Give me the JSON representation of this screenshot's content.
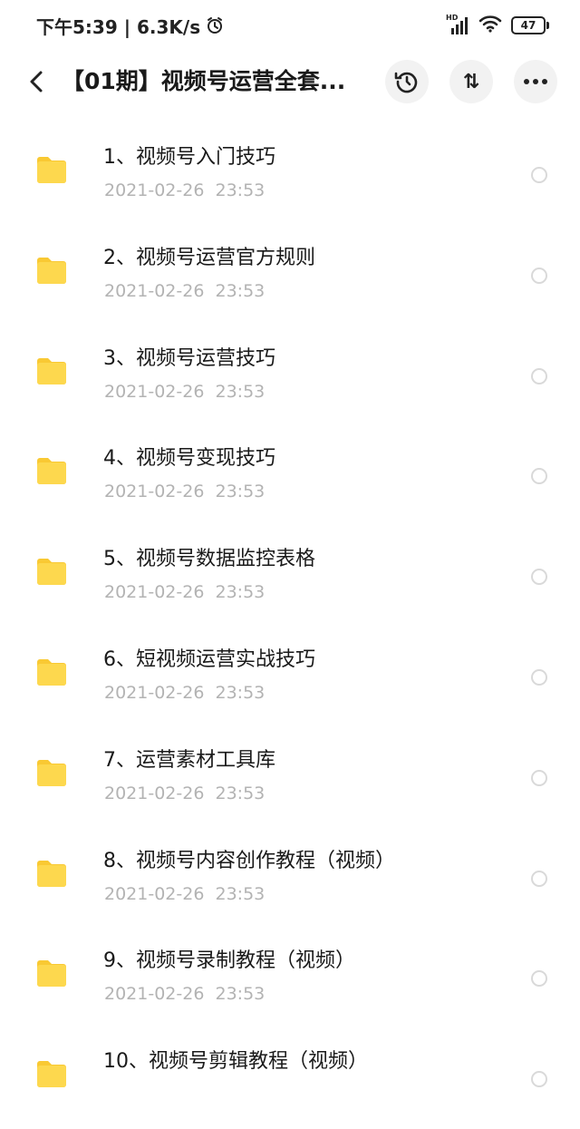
{
  "status_bar": {
    "time_speed": "下午5:39 | 6.3K/s",
    "hd_label": "HD",
    "battery": "47"
  },
  "header": {
    "title": "【01期】视频号运营全套...",
    "sort_label": "⇅"
  },
  "folders": [
    {
      "name": "1、视频号入门技巧",
      "date": "2021-02-26  23:53"
    },
    {
      "name": "2、视频号运营官方规则",
      "date": "2021-02-26  23:53"
    },
    {
      "name": "3、视频号运营技巧",
      "date": "2021-02-26  23:53"
    },
    {
      "name": "4、视频号变现技巧",
      "date": "2021-02-26  23:53"
    },
    {
      "name": "5、视频号数据监控表格",
      "date": "2021-02-26  23:53"
    },
    {
      "name": "6、短视频运营实战技巧",
      "date": "2021-02-26  23:53"
    },
    {
      "name": "7、运营素材工具库",
      "date": "2021-02-26  23:53"
    },
    {
      "name": "8、视频号内容创作教程（视频）",
      "date": "2021-02-26  23:53"
    },
    {
      "name": "9、视频号录制教程（视频）",
      "date": "2021-02-26  23:53"
    },
    {
      "name": "10、视频号剪辑教程（视频）",
      "date": ""
    }
  ],
  "colors": {
    "folder": "#fdd84e",
    "folder_tab": "#f9c933",
    "date_text": "#b3b3b3",
    "button_bg": "#f2f2f2"
  },
  "icons": [
    "alarm-icon",
    "signal-icon",
    "wifi-icon",
    "battery-icon",
    "back-icon",
    "history-icon",
    "sort-icon",
    "more-icon",
    "folder-icon",
    "radio-icon"
  ]
}
